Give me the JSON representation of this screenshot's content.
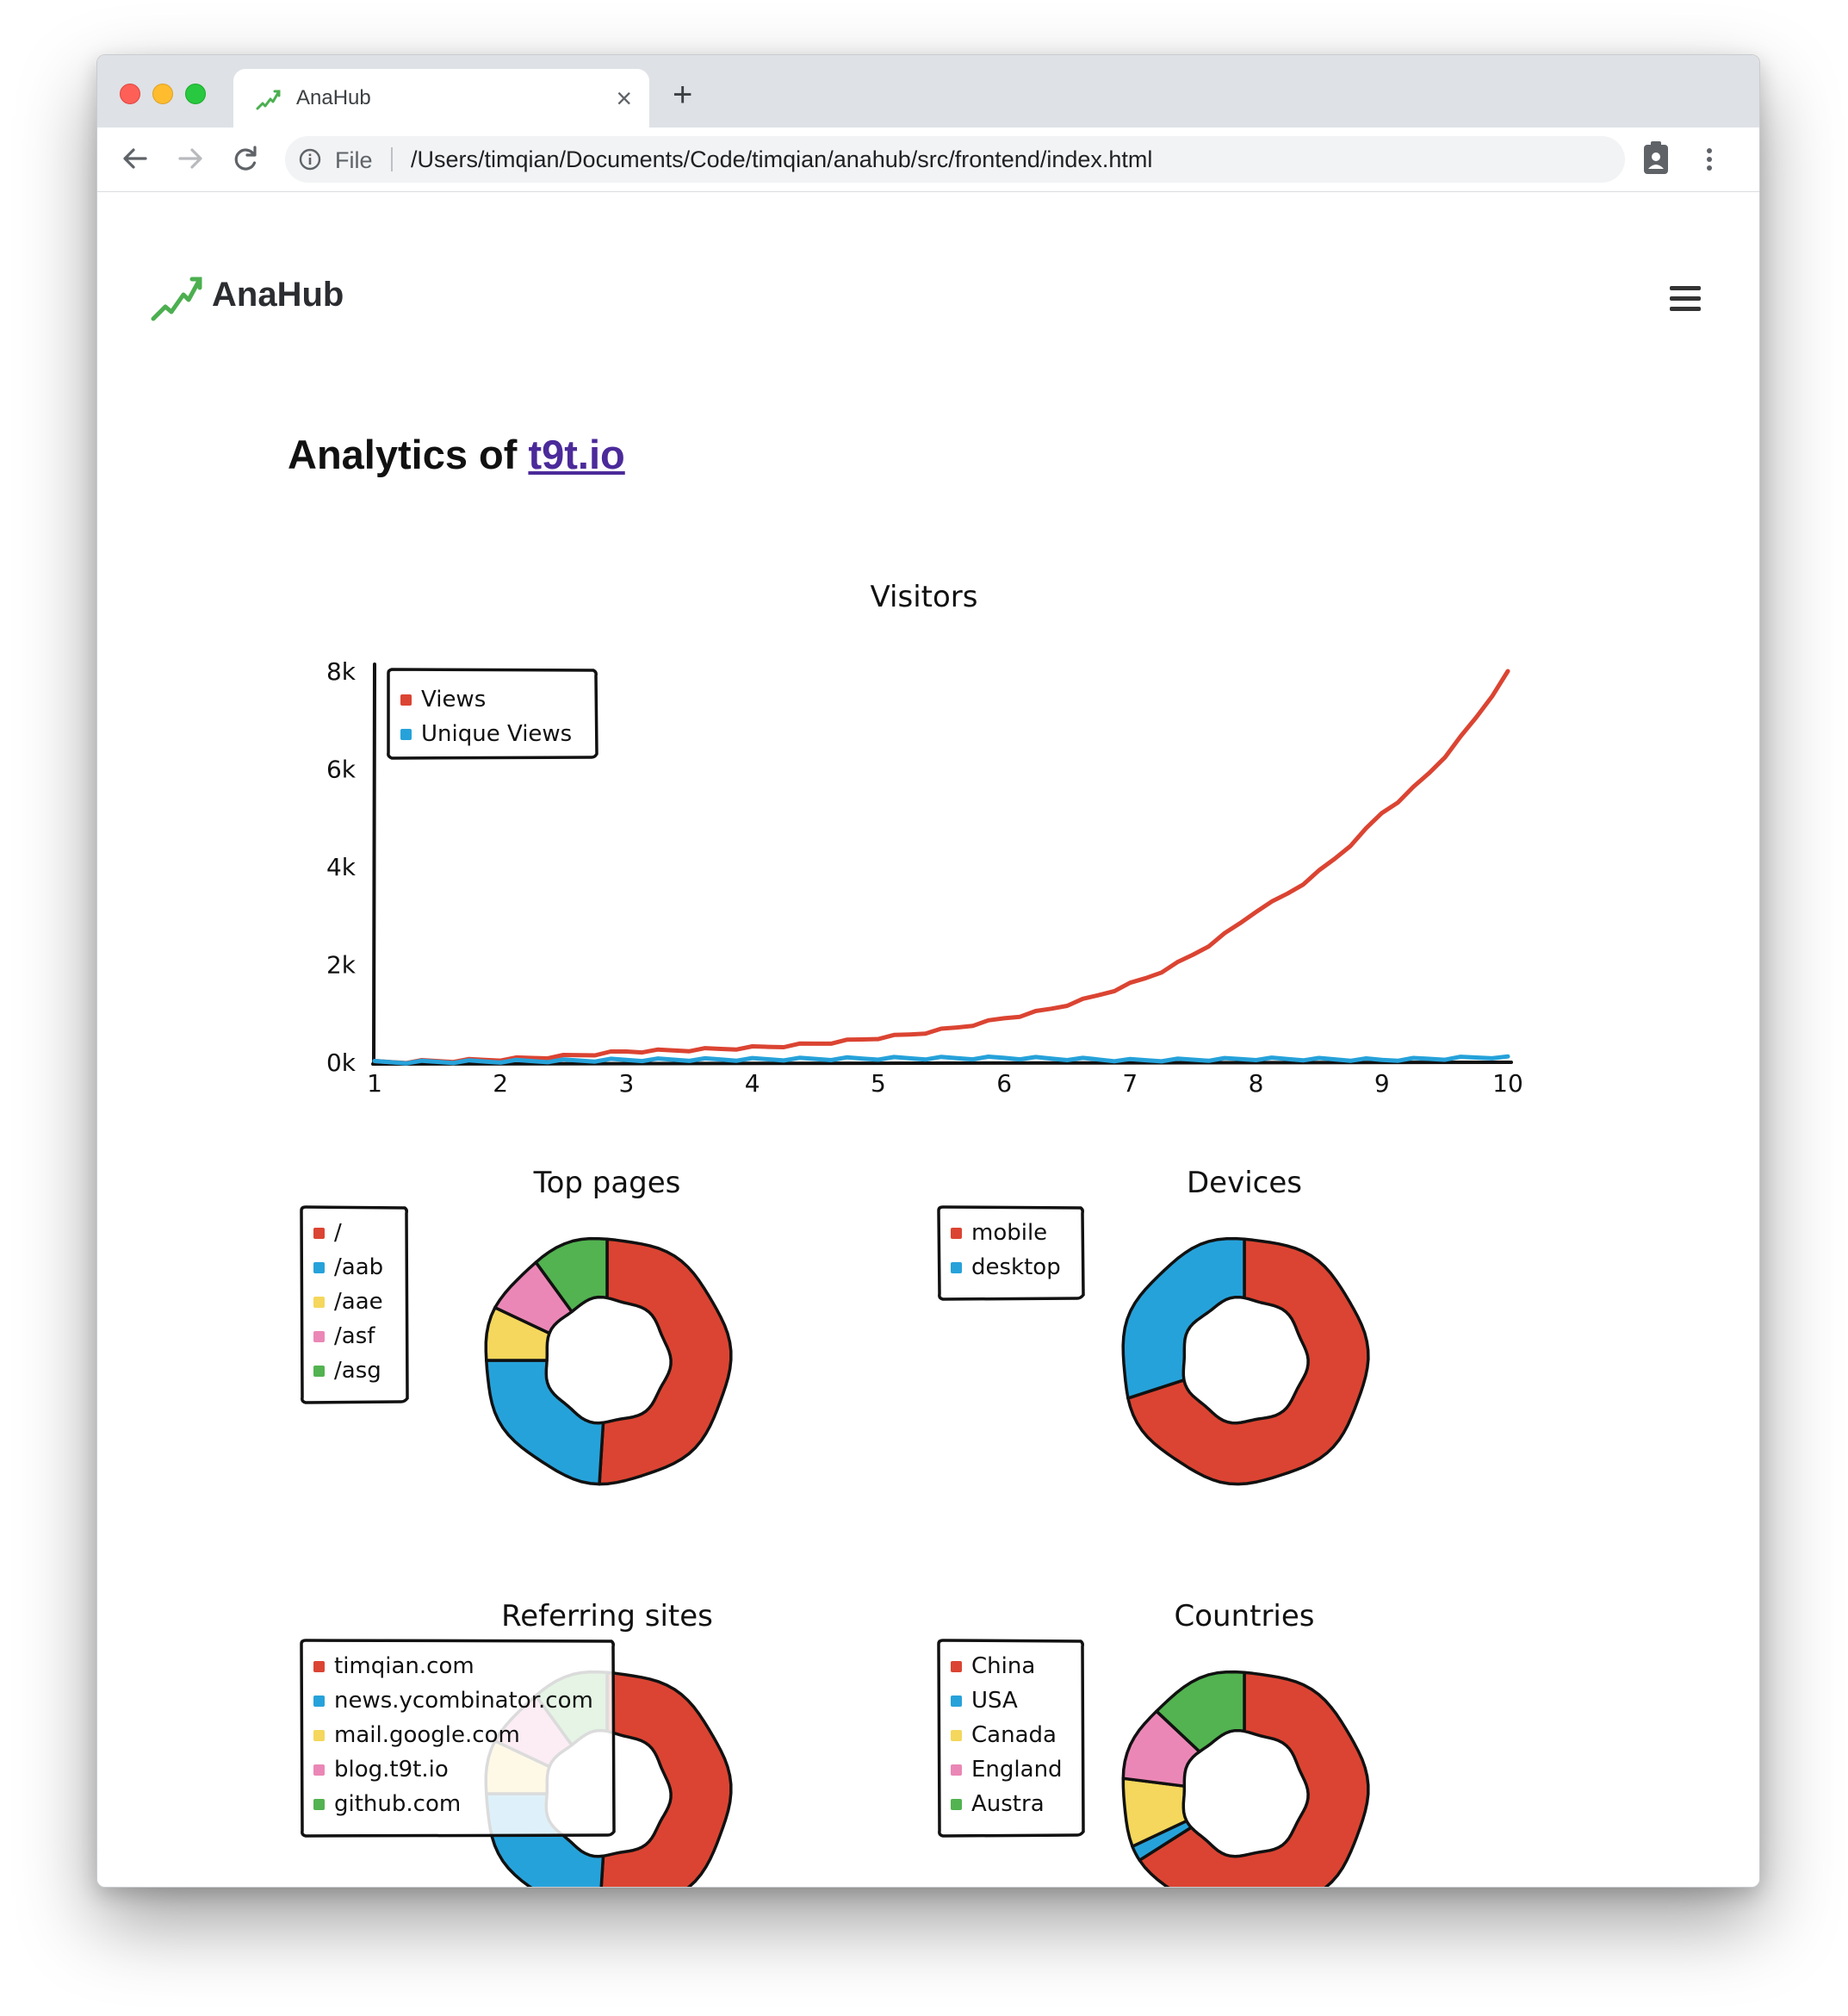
{
  "browser": {
    "tab_title": "AnaHub",
    "scheme_label": "File",
    "url": "/Users/timqian/Documents/Code/timqian/anahub/src/frontend/index.html"
  },
  "app": {
    "brand_name": "AnaHub",
    "heading_prefix": "Analytics of ",
    "heading_link": "t9t.io"
  },
  "colors": {
    "red": "#db4432",
    "blue": "#26a2da",
    "yellow": "#f4d75c",
    "pink": "#eb87b6",
    "green": "#52b350"
  },
  "chart_data": [
    {
      "type": "line",
      "title": "Visitors",
      "x": [
        1,
        2,
        3,
        4,
        5,
        6,
        7,
        8,
        9,
        10
      ],
      "ytick_labels": [
        "0k",
        "2k",
        "4k",
        "6k",
        "8k"
      ],
      "ylim": [
        0,
        8000
      ],
      "legend_position": "top-left",
      "series": [
        {
          "name": "Views",
          "color": "#db4432",
          "values": [
            0,
            60,
            220,
            300,
            500,
            900,
            1600,
            3100,
            5100,
            8000
          ]
        },
        {
          "name": "Unique Views",
          "color": "#26a2da",
          "values": [
            0,
            20,
            50,
            60,
            80,
            90,
            40,
            70,
            50,
            120
          ]
        }
      ]
    },
    {
      "type": "pie",
      "title": "Top pages",
      "legend_position": "left",
      "labels": [
        "/",
        "/aab",
        "/aae",
        "/asf",
        "/asg"
      ],
      "values": [
        51,
        24,
        7,
        8,
        10
      ]
    },
    {
      "type": "pie",
      "title": "Devices",
      "legend_position": "top-left",
      "labels": [
        "mobile",
        "desktop"
      ],
      "values": [
        70,
        30
      ]
    },
    {
      "type": "pie",
      "title": "Referring sites",
      "legend_position": "left",
      "labels": [
        "timqian.com",
        "news.ycombinator.com",
        "mail.google.com",
        "blog.t9t.io",
        "github.com"
      ],
      "values": [
        51,
        24,
        7,
        8,
        10
      ]
    },
    {
      "type": "pie",
      "title": "Countries",
      "legend_position": "top-left",
      "labels": [
        "China",
        "USA",
        "Canada",
        "England",
        "Austra"
      ],
      "values": [
        66,
        2,
        9,
        10,
        13
      ]
    }
  ]
}
